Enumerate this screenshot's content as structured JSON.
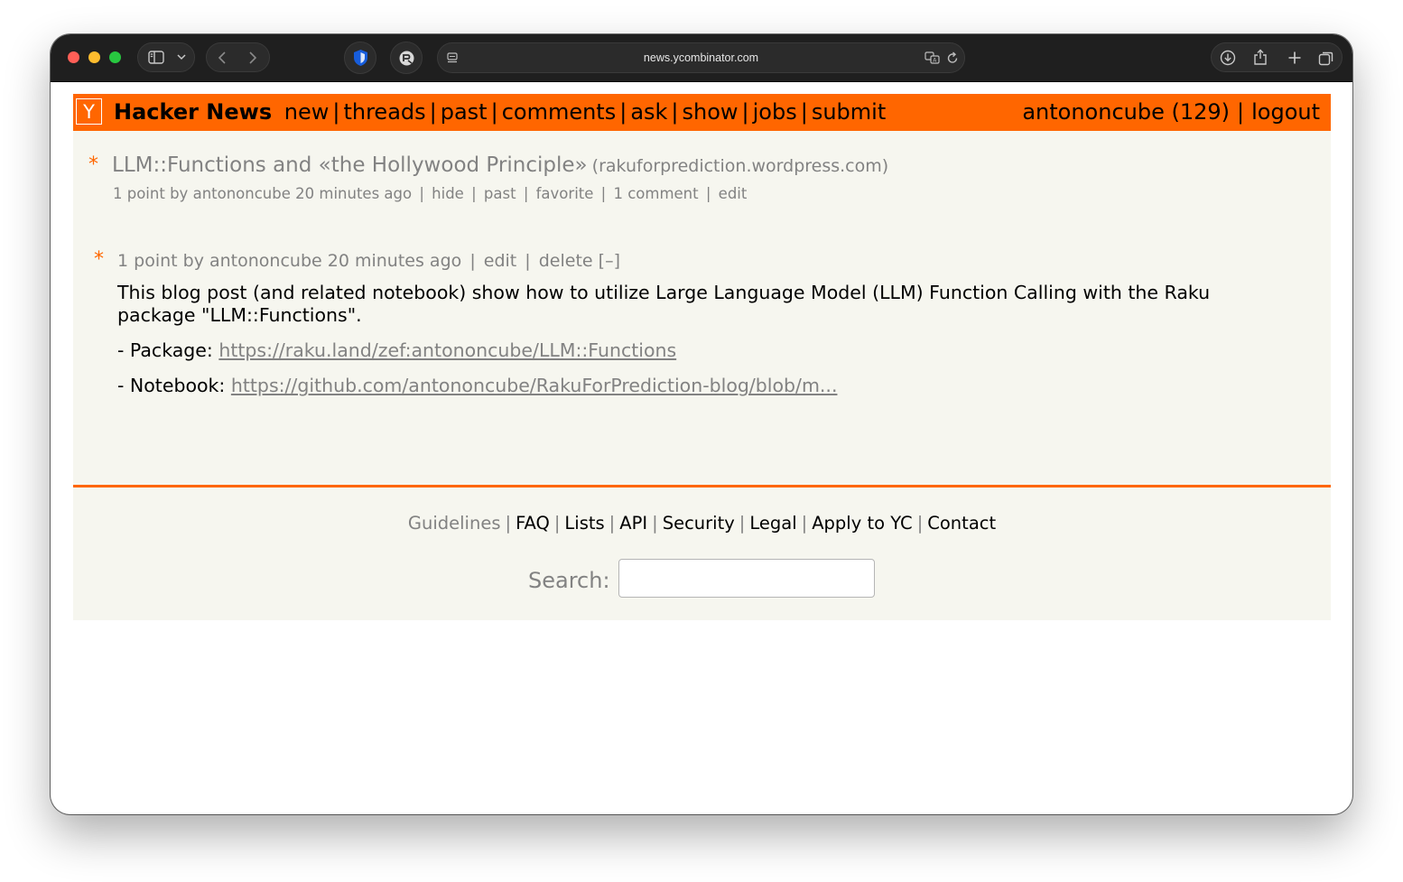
{
  "browser": {
    "url": "news.ycombinator.com"
  },
  "header": {
    "logo": "Y",
    "brand": "Hacker News",
    "nav": [
      "new",
      "threads",
      "past",
      "comments",
      "ask",
      "show",
      "jobs",
      "submit"
    ],
    "separator": "|",
    "user": "antononcube (129)",
    "logout": "logout"
  },
  "story": {
    "star": "*",
    "title": "LLM::Functions and «the Hollywood Principle»",
    "site": "(rakuforprediction.wordpress.com)",
    "points": "1 point",
    "by": "by",
    "author": "antononcube",
    "age": "20 minutes ago",
    "hide": "hide",
    "past": "past",
    "favorite": "favorite",
    "comments": "1 comment",
    "edit": "edit"
  },
  "comment": {
    "star": "*",
    "points": "1 point",
    "by": "by",
    "author": "antononcube",
    "age": "20 minutes ago",
    "edit": "edit",
    "delete": "delete",
    "toggle": "[–]",
    "text": "This blog post (and related notebook) show how to utilize Large Language Model (LLM) Function Calling with the Raku package \"LLM::Functions\".",
    "package_label": "- Package:",
    "package_link": "https://raku.land/zef:antononcube/LLM::Functions",
    "notebook_label": "- Notebook:",
    "notebook_link": "https://github.com/antononcube/RakuForPrediction-blog/blob/m..."
  },
  "footer": {
    "links": [
      "Guidelines",
      "FAQ",
      "Lists",
      "API",
      "Security",
      "Legal",
      "Apply to YC",
      "Contact"
    ],
    "search_label": "Search:",
    "search_value": ""
  },
  "colors": {
    "hn_orange": "#ff6600",
    "page_bg": "#f6f6ef",
    "subtext": "#828282"
  },
  "icons": [
    "sidebar-icon",
    "chevron-down-icon",
    "back-icon",
    "forward-icon",
    "bitwarden-shield-icon",
    "privacy-extension-icon",
    "reader-icon",
    "translate-icon",
    "reload-icon",
    "download-icon",
    "share-icon",
    "new-tab-icon",
    "tabs-overview-icon"
  ]
}
